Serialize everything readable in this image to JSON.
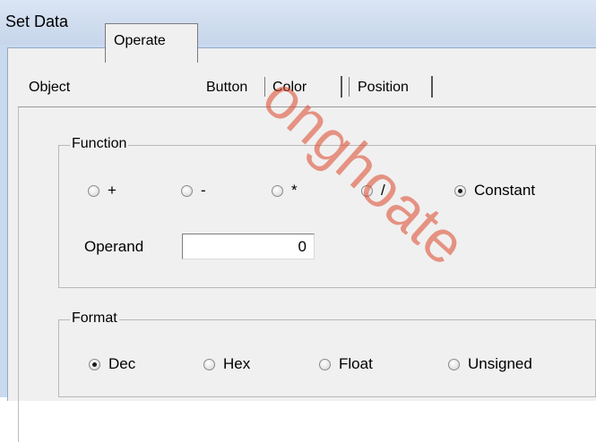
{
  "window": {
    "title": "Set Data"
  },
  "tabs": [
    {
      "label": "Object",
      "active": false
    },
    {
      "label": "Operate",
      "active": true
    },
    {
      "label": "Button",
      "active": false
    },
    {
      "label": "Color",
      "active": false
    },
    {
      "label": "Position",
      "active": false
    }
  ],
  "function_group": {
    "label": "Function",
    "options": [
      {
        "label": "+",
        "selected": false
      },
      {
        "label": "-",
        "selected": false
      },
      {
        "label": "*",
        "selected": false
      },
      {
        "label": "/",
        "selected": false
      },
      {
        "label": "Constant",
        "selected": true
      }
    ],
    "operand_label": "Operand",
    "operand_value": "0"
  },
  "format_group": {
    "label": "Format",
    "options": [
      {
        "label": "Dec",
        "selected": true
      },
      {
        "label": "Hex",
        "selected": false
      },
      {
        "label": "Float",
        "selected": false
      },
      {
        "label": "Unsigned",
        "selected": false
      }
    ]
  },
  "watermark": "onghoate",
  "colors": {
    "title_bar": "#d0ddef",
    "dialog_bg": "#f0f0f0",
    "watermark": "#dc4628"
  }
}
